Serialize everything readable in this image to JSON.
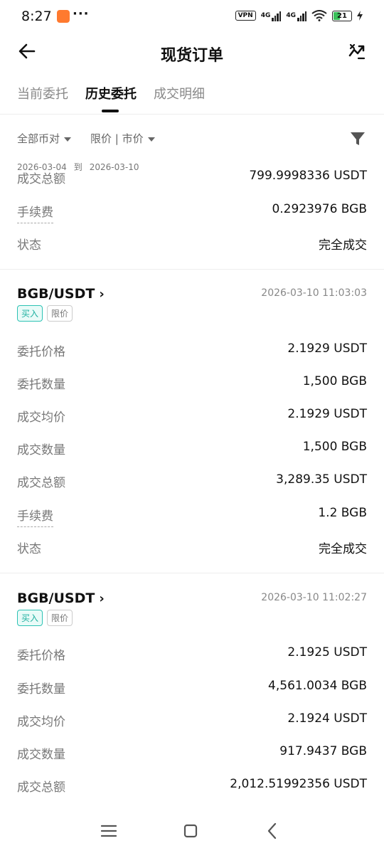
{
  "status_bar": {
    "time": "8:27",
    "dots": "···",
    "vpn": "VPN",
    "network_1": "4G",
    "network_2": "4G",
    "battery": "21"
  },
  "header": {
    "title": "现货订单"
  },
  "tabs": [
    {
      "label": "当前委托",
      "active": false
    },
    {
      "label": "历史委托",
      "active": true
    },
    {
      "label": "成交明细",
      "active": false
    }
  ],
  "filters": {
    "pair_filter": "全部币对",
    "type_filter": "限价 | 市价",
    "date_from": "2026-03-04",
    "date_sep": "到",
    "date_to": "2026-03-10"
  },
  "partial_order": {
    "rows": [
      {
        "key": "成交总额",
        "value": "799.9998336 USDT"
      },
      {
        "key": "手续费",
        "value": "0.2923976 BGB"
      },
      {
        "key": "状态",
        "value": "完全成交"
      }
    ]
  },
  "orders": [
    {
      "pair": "BGB/USDT",
      "chevron": "›",
      "time": "2026-03-10 11:03:03",
      "side": "买入",
      "type": "限价",
      "rows": [
        {
          "key": "委托价格",
          "value": "2.1929 USDT"
        },
        {
          "key": "委托数量",
          "value": "1,500 BGB"
        },
        {
          "key": "成交均价",
          "value": "2.1929 USDT"
        },
        {
          "key": "成交数量",
          "value": "1,500 BGB"
        },
        {
          "key": "成交总额",
          "value": "3,289.35 USDT"
        },
        {
          "key": "手续费",
          "value": "1.2 BGB"
        },
        {
          "key": "状态",
          "value": "完全成交"
        }
      ]
    },
    {
      "pair": "BGB/USDT",
      "chevron": "›",
      "time": "2026-03-10 11:02:27",
      "side": "买入",
      "type": "限价",
      "rows": [
        {
          "key": "委托价格",
          "value": "2.1925 USDT"
        },
        {
          "key": "委托数量",
          "value": "4,561.0034 BGB"
        },
        {
          "key": "成交均价",
          "value": "2.1924 USDT"
        },
        {
          "key": "成交数量",
          "value": "917.9437 BGB"
        },
        {
          "key": "成交总额",
          "value": "2,012.51992356 USDT"
        }
      ]
    }
  ]
}
